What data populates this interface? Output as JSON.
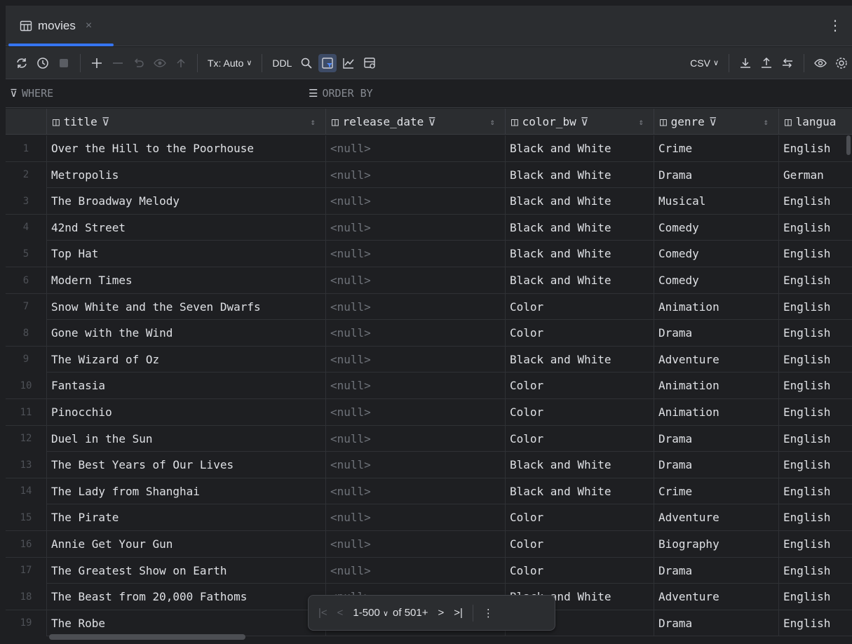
{
  "tab": {
    "title": "movies",
    "close": "×"
  },
  "toolbar": {
    "tx_mode": "Tx: Auto",
    "ddl": "DDL",
    "format": "CSV"
  },
  "filter": {
    "where": "WHERE",
    "order_by": "ORDER BY"
  },
  "columns": [
    "title",
    "release_date",
    "color_bw",
    "genre",
    "langua"
  ],
  "rows": [
    [
      "1",
      "Over the Hill to the Poorhouse",
      "<null>",
      "Black and White",
      "Crime",
      "English"
    ],
    [
      "2",
      "Metropolis",
      "<null>",
      "Black and White",
      "Drama",
      "German"
    ],
    [
      "3",
      "The Broadway Melody",
      "<null>",
      "Black and White",
      "Musical",
      "English"
    ],
    [
      "4",
      "42nd Street",
      "<null>",
      "Black and White",
      "Comedy",
      "English"
    ],
    [
      "5",
      "Top Hat",
      "<null>",
      "Black and White",
      "Comedy",
      "English"
    ],
    [
      "6",
      "Modern Times",
      "<null>",
      "Black and White",
      "Comedy",
      "English"
    ],
    [
      "7",
      "Snow White and the Seven Dwarfs",
      "<null>",
      "Color",
      "Animation",
      "English"
    ],
    [
      "8",
      "Gone with the Wind",
      "<null>",
      "Color",
      "Drama",
      "English"
    ],
    [
      "9",
      "The Wizard of Oz",
      "<null>",
      "Black and White",
      "Adventure",
      "English"
    ],
    [
      "10",
      "Fantasia",
      "<null>",
      "Color",
      "Animation",
      "English"
    ],
    [
      "11",
      "Pinocchio",
      "<null>",
      "Color",
      "Animation",
      "English"
    ],
    [
      "12",
      "Duel in the Sun",
      "<null>",
      "Color",
      "Drama",
      "English"
    ],
    [
      "13",
      "The Best Years of Our Lives",
      "<null>",
      "Black and White",
      "Drama",
      "English"
    ],
    [
      "14",
      "The Lady from Shanghai",
      "<null>",
      "Black and White",
      "Crime",
      "English"
    ],
    [
      "15",
      "The Pirate",
      "<null>",
      "Color",
      "Adventure",
      "English"
    ],
    [
      "16",
      "Annie Get Your Gun",
      "<null>",
      "Color",
      "Biography",
      "English"
    ],
    [
      "17",
      "The Greatest Show on Earth",
      "<null>",
      "Color",
      "Drama",
      "English"
    ],
    [
      "18",
      "The Beast from 20,000 Fathoms",
      "<null>",
      "Black and White",
      "Adventure",
      "English"
    ],
    [
      "19",
      "The Robe",
      "",
      "",
      "Drama",
      "English"
    ]
  ],
  "pager": {
    "range": "1-500",
    "total": "of 501+"
  },
  "colors": {
    "accent": "#3574f0",
    "background": "#1e1f22",
    "panel": "#2b2d30"
  }
}
